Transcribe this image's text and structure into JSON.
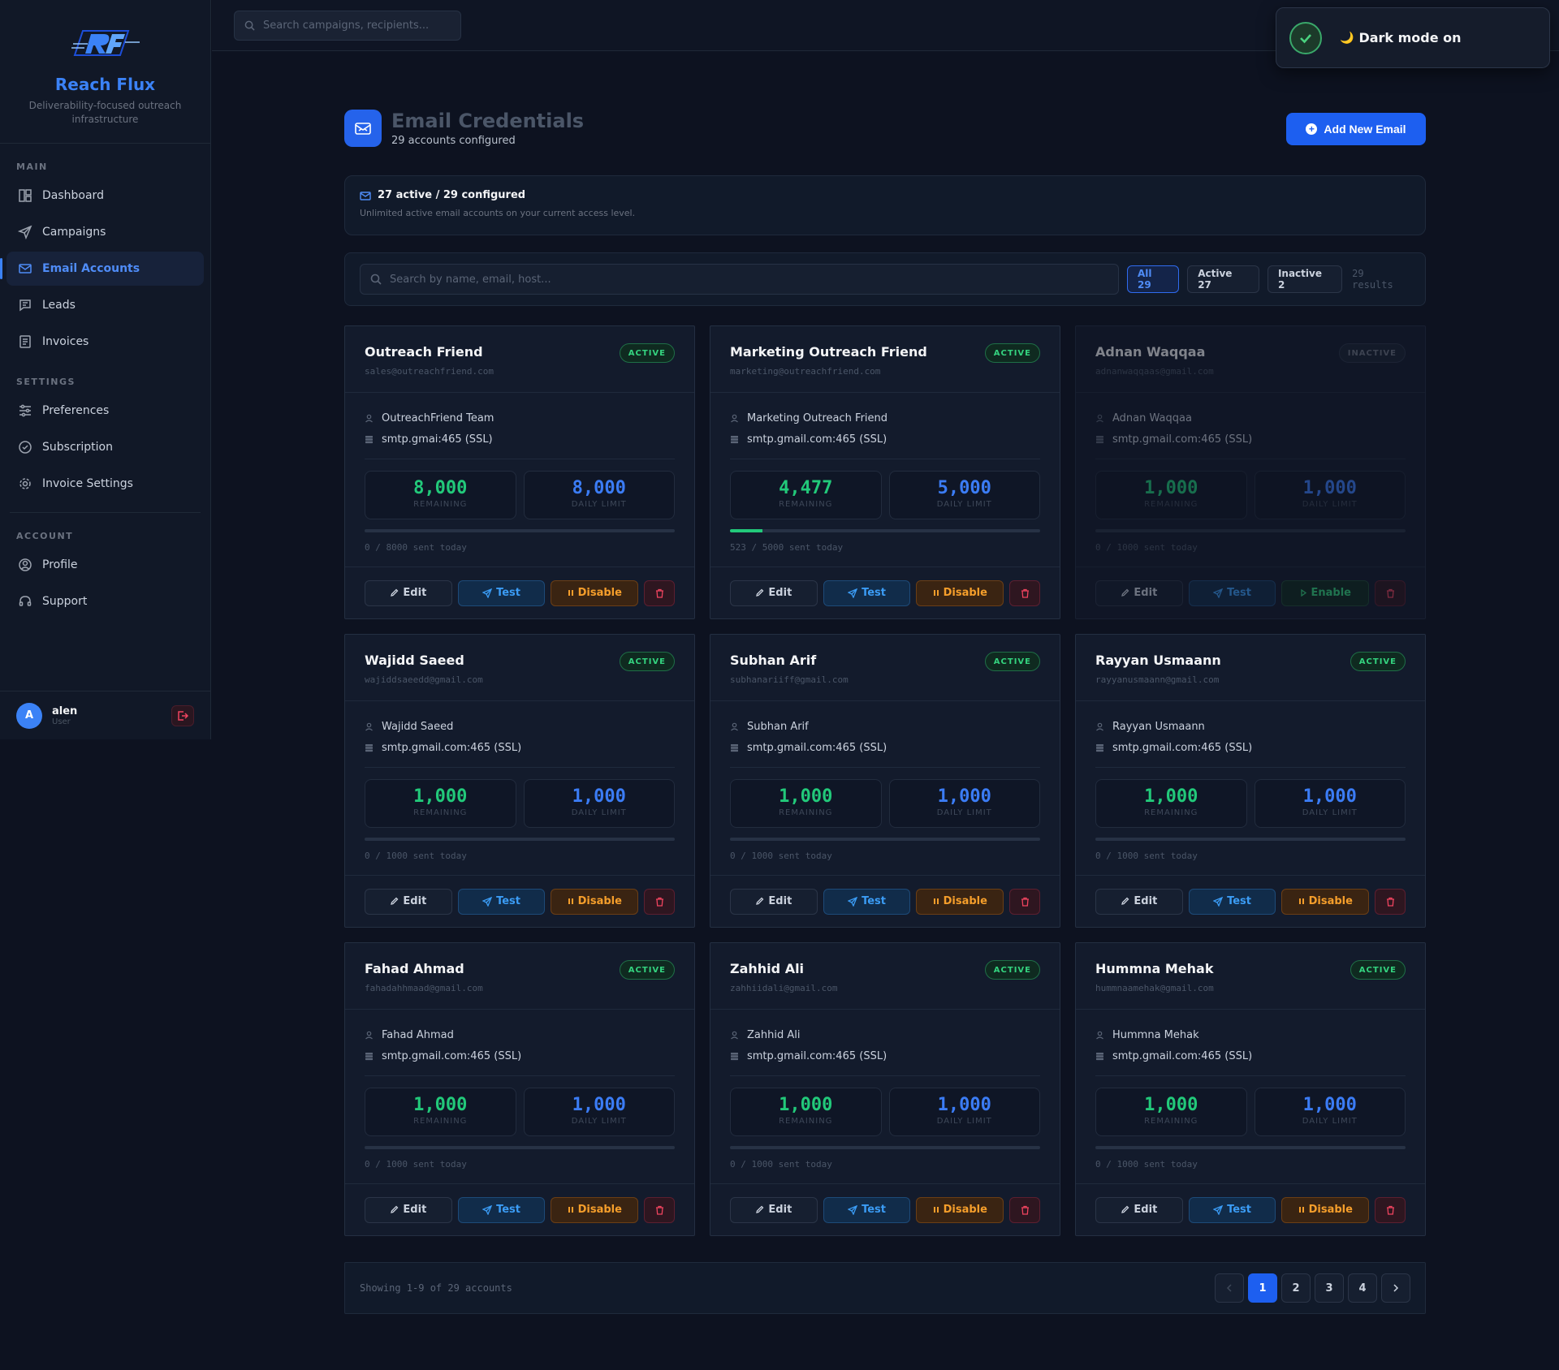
{
  "brand": {
    "name": "Reach Flux",
    "tagline": "Deliverability-focused outreach infrastructure"
  },
  "sidebar": {
    "main_label": "MAIN",
    "settings_label": "SETTINGS",
    "account_label": "ACCOUNT",
    "main_items": [
      {
        "label": "Dashboard",
        "icon": "dashboard-icon"
      },
      {
        "label": "Campaigns",
        "icon": "send-icon"
      },
      {
        "label": "Email Accounts",
        "icon": "mail-icon",
        "active": true
      },
      {
        "label": "Leads",
        "icon": "leads-icon"
      },
      {
        "label": "Invoices",
        "icon": "invoice-icon"
      }
    ],
    "settings_items": [
      {
        "label": "Preferences",
        "icon": "sliders-icon"
      },
      {
        "label": "Subscription",
        "icon": "check-circle-icon"
      },
      {
        "label": "Invoice Settings",
        "icon": "gear-icon"
      }
    ],
    "account_items": [
      {
        "label": "Profile",
        "icon": "user-circle-icon"
      },
      {
        "label": "Support",
        "icon": "headset-icon"
      }
    ],
    "user": {
      "initial": "A",
      "name": "alen",
      "role": "User"
    }
  },
  "topbar": {
    "search_placeholder": "Search campaigns, recipients..."
  },
  "toast": {
    "text": "Dark mode on",
    "moon": "🌙"
  },
  "header": {
    "title": "Email Credentials",
    "subtitle": "29 accounts configured",
    "add_label": "Add New Email",
    "add_plus": "+"
  },
  "summary": {
    "title": "27 active / 29 configured",
    "subtitle": "Unlimited active email accounts on your current access level."
  },
  "filters": {
    "placeholder": "Search by name, email, host...",
    "chips": [
      "All 29",
      "Active 27",
      "Inactive 2"
    ],
    "results": "29 results"
  },
  "labels": {
    "remaining": "REMAINING",
    "daily_limit": "DAILY LIMIT",
    "edit": "Edit",
    "test": "Test",
    "disable": "Disable",
    "enable": "Enable"
  },
  "accounts": [
    {
      "name": "Outreach Friend",
      "email": "sales@outreachfriend.com",
      "status": "ACTIVE",
      "sender": "OutreachFriend Team",
      "host": "smtp.gmai:465 (SSL)",
      "remaining": "8,000",
      "limit": "8,000",
      "sent_fraction": 0,
      "sent_text": "0 / 8000 sent today",
      "toggle": "Disable"
    },
    {
      "name": "Marketing Outreach Friend",
      "email": "marketing@outreachfriend.com",
      "status": "ACTIVE",
      "sender": "Marketing Outreach Friend",
      "host": "smtp.gmail.com:465 (SSL)",
      "remaining": "4,477",
      "limit": "5,000",
      "sent_fraction": 0.1046,
      "sent_text": "523 / 5000 sent today",
      "toggle": "Disable"
    },
    {
      "name": "Adnan Waqqaa",
      "email": "adnanwaqqaas@gmail.com",
      "status": "INACTIVE",
      "sender": "Adnan Waqqaa",
      "host": "smtp.gmail.com:465 (SSL)",
      "remaining": "1,000",
      "limit": "1,000",
      "sent_fraction": 0,
      "sent_text": "0 / 1000 sent today",
      "toggle": "Enable"
    },
    {
      "name": "Wajidd Saeed",
      "email": "wajiddsaeedd@gmail.com",
      "status": "ACTIVE",
      "sender": "Wajidd Saeed",
      "host": "smtp.gmail.com:465 (SSL)",
      "remaining": "1,000",
      "limit": "1,000",
      "sent_fraction": 0,
      "sent_text": "0 / 1000 sent today",
      "toggle": "Disable"
    },
    {
      "name": "Subhan Arif",
      "email": "subhanariiff@gmail.com",
      "status": "ACTIVE",
      "sender": "Subhan Arif",
      "host": "smtp.gmail.com:465 (SSL)",
      "remaining": "1,000",
      "limit": "1,000",
      "sent_fraction": 0,
      "sent_text": "0 / 1000 sent today",
      "toggle": "Disable"
    },
    {
      "name": "Rayyan Usmaann",
      "email": "rayyanusmaann@gmail.com",
      "status": "ACTIVE",
      "sender": "Rayyan Usmaann",
      "host": "smtp.gmail.com:465 (SSL)",
      "remaining": "1,000",
      "limit": "1,000",
      "sent_fraction": 0,
      "sent_text": "0 / 1000 sent today",
      "toggle": "Disable"
    },
    {
      "name": "Fahad Ahmad",
      "email": "fahadahhmaad@gmail.com",
      "status": "ACTIVE",
      "sender": "Fahad Ahmad",
      "host": "smtp.gmail.com:465 (SSL)",
      "remaining": "1,000",
      "limit": "1,000",
      "sent_fraction": 0,
      "sent_text": "0 / 1000 sent today",
      "toggle": "Disable"
    },
    {
      "name": "Zahhid Ali",
      "email": "zahhiidali@gmail.com",
      "status": "ACTIVE",
      "sender": "Zahhid Ali",
      "host": "smtp.gmail.com:465 (SSL)",
      "remaining": "1,000",
      "limit": "1,000",
      "sent_fraction": 0,
      "sent_text": "0 / 1000 sent today",
      "toggle": "Disable"
    },
    {
      "name": "Hummna Mehak",
      "email": "hummnaamehak@gmail.com",
      "status": "ACTIVE",
      "sender": "Hummna Mehak",
      "host": "smtp.gmail.com:465 (SSL)",
      "remaining": "1,000",
      "limit": "1,000",
      "sent_fraction": 0,
      "sent_text": "0 / 1000 sent today",
      "toggle": "Disable"
    }
  ],
  "pagination": {
    "text": "Showing 1-9 of 29 accounts",
    "pages": [
      "1",
      "2",
      "3",
      "4"
    ],
    "current": "1"
  },
  "colors": {
    "accent": "#1d5ff0",
    "active_green": "#22c97a",
    "limit_blue": "#3b7cf5",
    "warning_orange": "#f59e2b",
    "danger_red": "#f0445f"
  }
}
